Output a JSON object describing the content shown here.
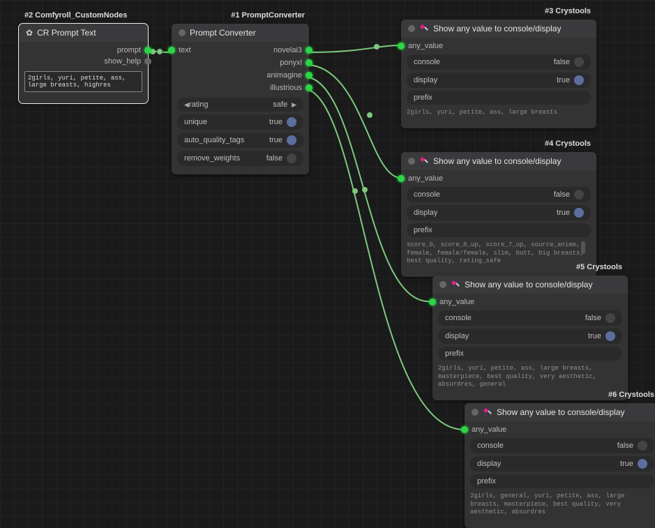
{
  "colors": {
    "port_green": "#2bd646",
    "port_gray": "#666"
  },
  "node_cr": {
    "tag": "#2 Comfyroll_CustomNodes",
    "title": "CR Prompt Text",
    "outputs": [
      "prompt",
      "show_help"
    ],
    "text": "2girls, yuri, petite, ass, large breasts, highres"
  },
  "node_pc": {
    "tag": "#1 PromptConverter",
    "title": "Prompt Converter",
    "input": "text",
    "outputs": [
      "novelai3",
      "ponyxl",
      "animagine",
      "illustrious"
    ],
    "widgets": {
      "rating": {
        "label": "rating",
        "value": "safe"
      },
      "unique": {
        "label": "unique",
        "value": "true",
        "on": true
      },
      "auto_quality_tags": {
        "label": "auto_quality_tags",
        "value": "true",
        "on": true
      },
      "remove_weights": {
        "label": "remove_weights",
        "value": "false",
        "on": false
      }
    }
  },
  "show_nodes": [
    {
      "tag": "#3 Crystools",
      "title": "Show any value to console/display",
      "input": "any_value",
      "console": {
        "label": "console",
        "value": "false",
        "on": false
      },
      "display": {
        "label": "display",
        "value": "true",
        "on": true
      },
      "prefix": {
        "label": "prefix",
        "value": ""
      },
      "output": "2girls, yuri, petite, ass, large breasts"
    },
    {
      "tag": "#4 Crystools",
      "title": "Show any value to console/display",
      "input": "any_value",
      "console": {
        "label": "console",
        "value": "false",
        "on": false
      },
      "display": {
        "label": "display",
        "value": "true",
        "on": true
      },
      "prefix": {
        "label": "prefix",
        "value": ""
      },
      "output": "score_9, score_8_up, score_7_up, source_anime, female, female/female, slim, butt, big breasts, best quality, rating_safe"
    },
    {
      "tag": "#5 Crystools",
      "title": "Show any value to console/display",
      "input": "any_value",
      "console": {
        "label": "console",
        "value": "false",
        "on": false
      },
      "display": {
        "label": "display",
        "value": "true",
        "on": true
      },
      "prefix": {
        "label": "prefix",
        "value": ""
      },
      "output": "2girls, yuri, petite, ass, large breasts, masterpiece, best quality, very aesthetic, absurdres, general"
    },
    {
      "tag": "#6 Crystools",
      "title": "Show any value to console/display",
      "input": "any_value",
      "console": {
        "label": "console",
        "value": "false",
        "on": false
      },
      "display": {
        "label": "display",
        "value": "true",
        "on": true
      },
      "prefix": {
        "label": "prefix",
        "value": ""
      },
      "output": "2girls, general, yuri, petite, ass, large breasts, masterpiece, best quality, very aesthetic, absurdres"
    }
  ]
}
